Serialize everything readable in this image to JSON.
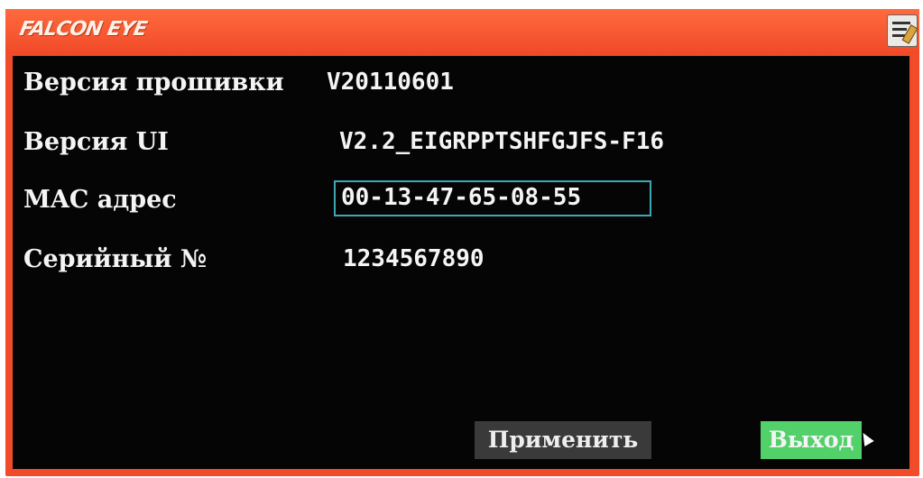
{
  "titlebar": {
    "logo_text": "FALCON EYE",
    "menu_icon": "menu-icon"
  },
  "info": {
    "firmware_label": "Версия прошивки",
    "firmware_value": "V20110601",
    "ui_label": "Версия UI",
    "ui_value": "V2.2_EIGRPPTSHFGJFS-F16",
    "mac_label": "MAC адрес",
    "mac_value": "00-13-47-65-08-55",
    "serial_label": "Серийный №",
    "serial_value": "1234567890"
  },
  "buttons": {
    "apply_label": "Применить",
    "exit_label": "Выход"
  },
  "colors": {
    "frame": "#f24b2a",
    "panel": "#050505",
    "focus_border": "#3fa7b3",
    "exit_button": "#52d06a",
    "apply_button": "#3a3a3a"
  }
}
